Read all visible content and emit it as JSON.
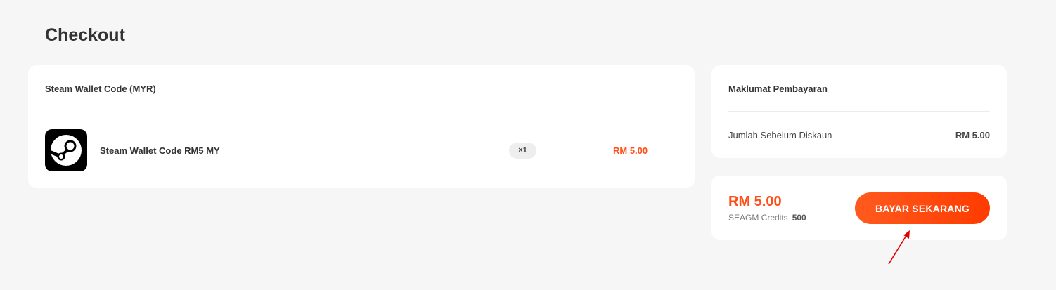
{
  "page": {
    "title": "Checkout"
  },
  "order": {
    "header": "Steam Wallet Code (MYR)",
    "item": {
      "icon": "steam-logo-icon",
      "name": "Steam Wallet Code RM5 MY",
      "quantity": "×1",
      "price": "RM 5.00"
    }
  },
  "payment_info": {
    "header": "Maklumat Pembayaran",
    "subtotal_label": "Jumlah Sebelum Diskaun",
    "subtotal_value": "RM 5.00"
  },
  "summary": {
    "total": "RM 5.00",
    "credits_label": "SEAGM Credits",
    "credits_value": "500",
    "pay_button": "BAYAR SEKARANG"
  },
  "annotation": {
    "icon": "red-arrow-icon",
    "color": "#e00000"
  },
  "colors": {
    "accent": "#ff4e17",
    "background": "#f6f6f6",
    "card": "#ffffff"
  }
}
